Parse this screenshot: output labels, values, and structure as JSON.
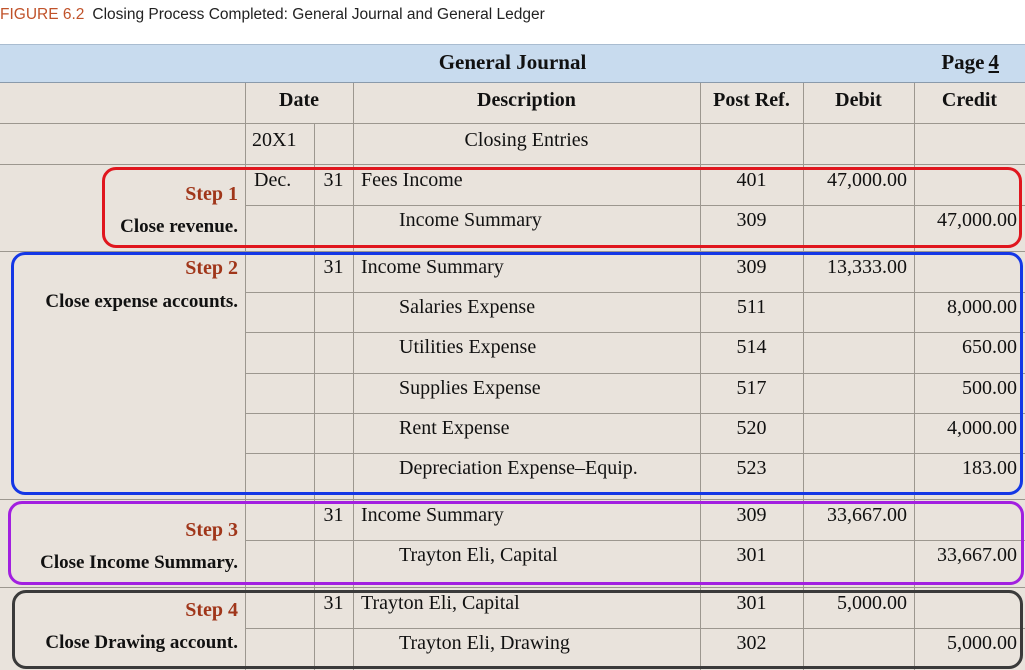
{
  "figure": {
    "number": "FIGURE 6.2",
    "title": "Closing Process Completed: General Journal and General Ledger"
  },
  "journal": {
    "title": "General Journal",
    "page_label": "Page",
    "page_number": "4"
  },
  "headers": {
    "date": "Date",
    "description": "Description",
    "post_ref": "Post Ref.",
    "debit": "Debit",
    "credit": "Credit"
  },
  "subheader": {
    "year": "20X1",
    "title": "Closing Entries"
  },
  "steps": [
    {
      "label": "Step 1",
      "description": "Close revenue.",
      "color": "#e0161e"
    },
    {
      "label": "Step 2",
      "description": "Close expense accounts.",
      "color": "#1437e6"
    },
    {
      "label": "Step 3",
      "description": "Close Income Summary.",
      "color": "#a21fe0"
    },
    {
      "label": "Step 4",
      "description": "Close Drawing account.",
      "color": "#3a3a3a"
    }
  ],
  "rows": [
    {
      "month": "Dec.",
      "day": "31",
      "description": "Fees Income",
      "post_ref": "401",
      "debit": "47,000.00",
      "credit": ""
    },
    {
      "month": "",
      "day": "",
      "description": "Income Summary",
      "post_ref": "309",
      "debit": "",
      "credit": "47,000.00"
    },
    {
      "month": "",
      "day": "31",
      "description": "Income Summary",
      "post_ref": "309",
      "debit": "13,333.00",
      "credit": ""
    },
    {
      "month": "",
      "day": "",
      "description": "Salaries Expense",
      "post_ref": "511",
      "debit": "",
      "credit": "8,000.00"
    },
    {
      "month": "",
      "day": "",
      "description": "Utilities Expense",
      "post_ref": "514",
      "debit": "",
      "credit": "650.00"
    },
    {
      "month": "",
      "day": "",
      "description": "Supplies Expense",
      "post_ref": "517",
      "debit": "",
      "credit": "500.00"
    },
    {
      "month": "",
      "day": "",
      "description": "Rent Expense",
      "post_ref": "520",
      "debit": "",
      "credit": "4,000.00"
    },
    {
      "month": "",
      "day": "",
      "description": "Depreciation Expense–Equip.",
      "post_ref": "523",
      "debit": "",
      "credit": "183.00"
    },
    {
      "month": "",
      "day": "31",
      "description": "Income Summary",
      "post_ref": "309",
      "debit": "33,667.00",
      "credit": ""
    },
    {
      "month": "",
      "day": "",
      "description": "Trayton Eli, Capital",
      "post_ref": "301",
      "debit": "",
      "credit": "33,667.00"
    },
    {
      "month": "",
      "day": "31",
      "description": "Trayton Eli, Capital",
      "post_ref": "301",
      "debit": "5,000.00",
      "credit": ""
    },
    {
      "month": "",
      "day": "",
      "description": "Trayton Eli, Drawing",
      "post_ref": "302",
      "debit": "",
      "credit": "5,000.00"
    }
  ]
}
